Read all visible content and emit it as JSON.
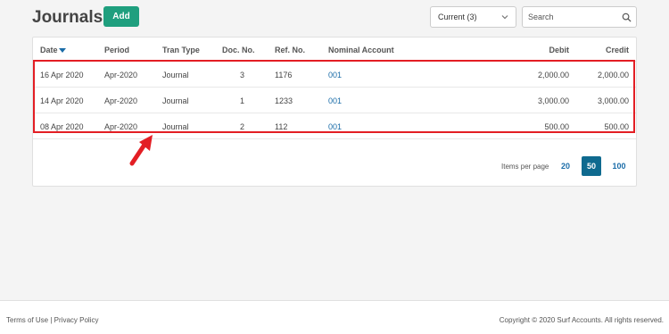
{
  "header": {
    "title": "Journals",
    "add_label": "Add",
    "filter_value": "Current (3)",
    "search_placeholder": "Search"
  },
  "table": {
    "columns": {
      "date": "Date",
      "period": "Period",
      "tran_type": "Tran Type",
      "doc_no": "Doc. No.",
      "ref_no": "Ref. No.",
      "nominal_account": "Nominal Account",
      "debit": "Debit",
      "credit": "Credit"
    },
    "rows": [
      {
        "date": "16 Apr 2020",
        "period": "Apr-2020",
        "tran_type": "Journal",
        "doc_no": "3",
        "ref_no": "1176",
        "nominal_account": "001",
        "debit": "2,000.00",
        "credit": "2,000.00"
      },
      {
        "date": "14 Apr 2020",
        "period": "Apr-2020",
        "tran_type": "Journal",
        "doc_no": "1",
        "ref_no": "1233",
        "nominal_account": "001",
        "debit": "3,000.00",
        "credit": "3,000.00"
      },
      {
        "date": "08 Apr 2020",
        "period": "Apr-2020",
        "tran_type": "Journal",
        "doc_no": "2",
        "ref_no": "112",
        "nominal_account": "001",
        "debit": "500.00",
        "credit": "500.00"
      }
    ]
  },
  "pagination": {
    "label": "Items per page",
    "options": [
      "20",
      "50",
      "100"
    ],
    "selected": "50"
  },
  "footer": {
    "terms": "Terms of Use",
    "separator": "|",
    "privacy": "Privacy Policy",
    "copyright": "Copyright © 2020 Surf Accounts. All rights reserved."
  },
  "colors": {
    "accent_green": "#1f9f7e",
    "link_blue": "#1a6ca8",
    "active_page": "#0f6a8f",
    "highlight_red": "#e31e24"
  },
  "icons": {
    "sort": "caret-down-icon",
    "filter": "chevron-down-icon",
    "search": "search-icon",
    "annotation": "red-arrow-icon"
  }
}
